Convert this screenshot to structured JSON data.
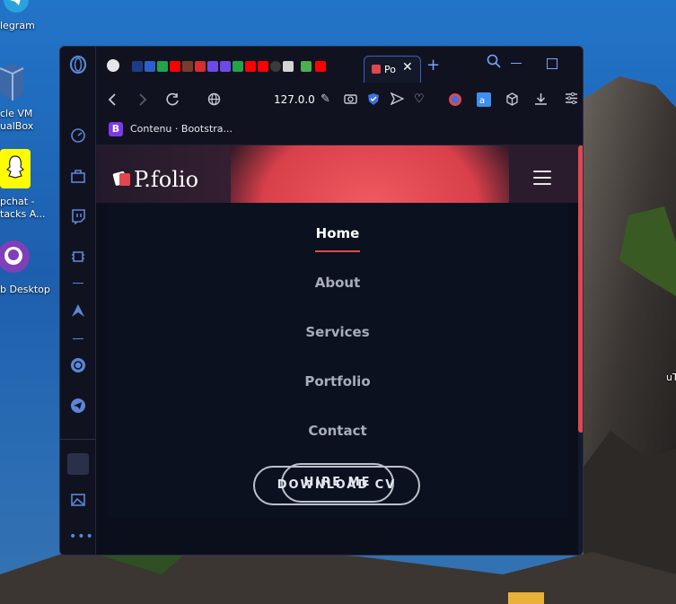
{
  "desktop": {
    "icons": [
      {
        "label": "legram",
        "color": "#29a3e0"
      },
      {
        "label": "cle VM",
        "label2": "ualBox",
        "color": "#3c68a8"
      },
      {
        "label": "pchat -",
        "label2": "tacks A...",
        "color": "#fffc00"
      },
      {
        "label": "b Desktop",
        "color": "#7e3fb8"
      }
    ],
    "right_label": "uT"
  },
  "browser": {
    "active_tab_label": "Po",
    "url": "127.0.0",
    "bookmark": {
      "icon_letter": "B",
      "label": "Contenu · Bootstra..."
    }
  },
  "site": {
    "logo_text": "P.folio",
    "nav": [
      {
        "label": "Home",
        "active": true
      },
      {
        "label": "About",
        "active": false
      },
      {
        "label": "Services",
        "active": false
      },
      {
        "label": "Portfolio",
        "active": false
      },
      {
        "label": "Contact",
        "active": false
      }
    ],
    "hire_button": "HIRE ME",
    "download_button": "DOWNLOAD CV",
    "accent": "#e2474f"
  }
}
